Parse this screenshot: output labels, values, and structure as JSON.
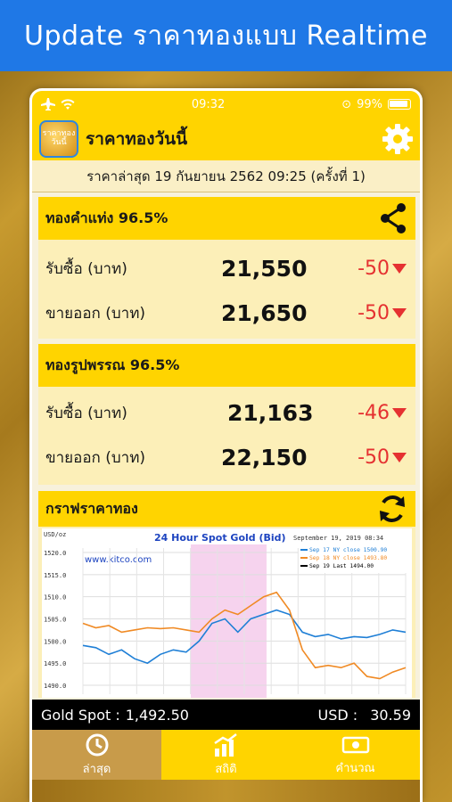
{
  "banner": {
    "title": "Update ราคาทองแบบ Realtime"
  },
  "statusbar": {
    "time": "09:32",
    "battery": "99%"
  },
  "app": {
    "logo_text": "ราคาทองวันนี้",
    "title": "ราคาทองวันนี้"
  },
  "updated": {
    "text": "ราคาล่าสุด 19 กันยายน 2562  09:25  (ครั้งที่ 1)"
  },
  "bar_gold": {
    "title": "ทองคำแท่ง 96.5%",
    "rows": [
      {
        "label": "รับซื้อ (บาท)",
        "value": "21,550",
        "change": "-50"
      },
      {
        "label": "ขายออก (บาท)",
        "value": "21,650",
        "change": "-50"
      }
    ]
  },
  "ornament_gold": {
    "title": "ทองรูปพรรณ 96.5%",
    "rows": [
      {
        "label": "รับซื้อ (บาท)",
        "value": "21,163",
        "change": "-46"
      },
      {
        "label": "ขายออก (บาท)",
        "value": "22,150",
        "change": "-50"
      }
    ]
  },
  "graph": {
    "title": "กราฟราคาทอง",
    "chart_title": "24 Hour Spot Gold (Bid)",
    "date_label": "September 19, 2019 08:34",
    "unit_label": "USD/oz",
    "watermark": "www.kitco.com",
    "legend": [
      {
        "text": "Sep 17 NY close 1500.90",
        "color": "#1f7fd6"
      },
      {
        "text": "Sep 18 NY close 1493.80",
        "color": "#f08a24"
      },
      {
        "text": "Sep 19 Last 1494.00",
        "color": "#000000"
      }
    ],
    "yticks": [
      "1520.0",
      "1515.0",
      "1510.0",
      "1505.0",
      "1500.0",
      "1495.0",
      "1490.0"
    ]
  },
  "chart_data": {
    "type": "line",
    "title": "24 Hour Spot Gold (Bid)",
    "ylabel": "USD/oz",
    "ylim": [
      1488,
      1521
    ],
    "series": [
      {
        "name": "Sep 17 NY close 1500.90",
        "values": [
          1499,
          1498.5,
          1497,
          1498,
          1496,
          1495,
          1497,
          1498,
          1497.5,
          1500,
          1504,
          1505,
          1502,
          1505,
          1506,
          1507,
          1506,
          1502,
          1501,
          1501.5,
          1500.5,
          1501,
          1500.8,
          1501.5,
          1502.5,
          1502
        ]
      },
      {
        "name": "Sep 18 NY close 1493.80",
        "values": [
          1504,
          1503,
          1503.5,
          1502,
          1502.5,
          1503,
          1502.8,
          1503,
          1502.5,
          1502,
          1505,
          1507,
          1506,
          1508,
          1510,
          1511,
          1507,
          1498,
          1494,
          1494.5,
          1494,
          1495,
          1492,
          1491.5,
          1493,
          1494
        ]
      }
    ]
  },
  "spot": {
    "gold_label": "Gold Spot :",
    "gold_value": "1,492.50",
    "usd_label": "USD :",
    "usd_value": "30.59"
  },
  "tabs": [
    {
      "label": "ล่าสุด",
      "icon": "clock-icon"
    },
    {
      "label": "สถิติ",
      "icon": "stats-icon"
    },
    {
      "label": "คำนวณ",
      "icon": "money-icon"
    }
  ]
}
